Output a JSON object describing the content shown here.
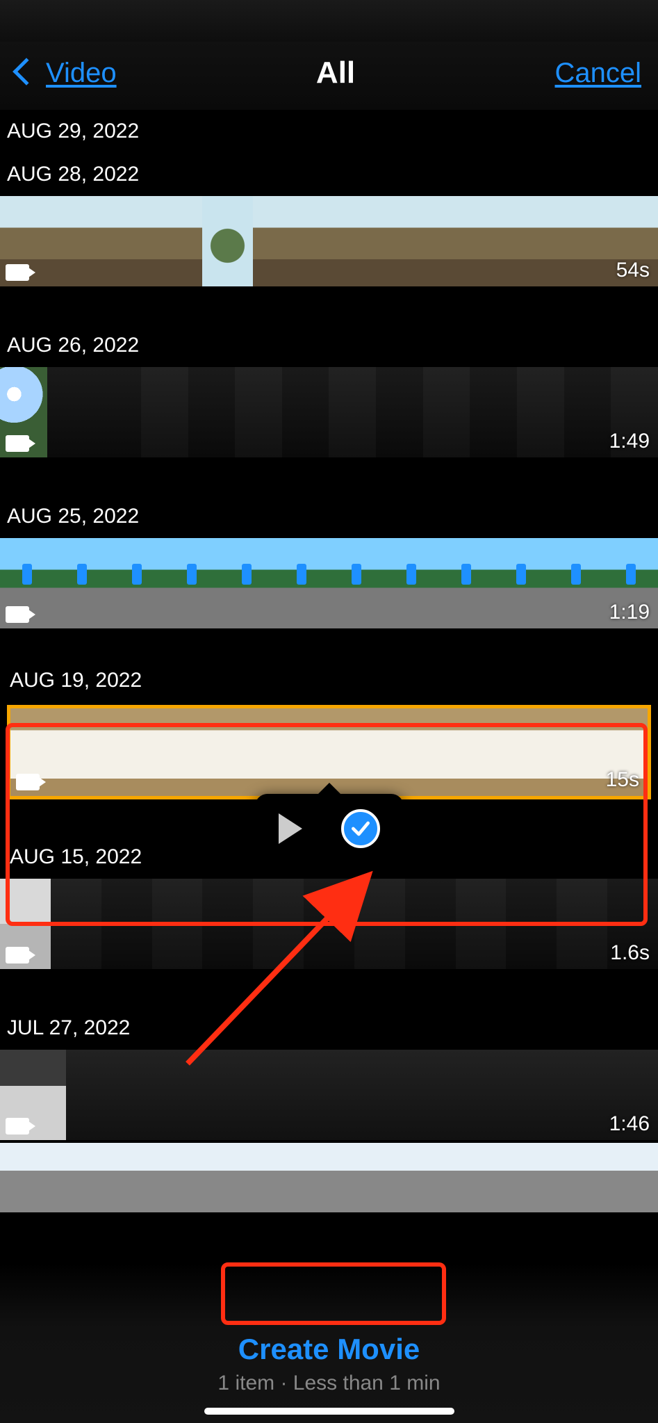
{
  "nav": {
    "back_label": "Video",
    "title": "All",
    "cancel_label": "Cancel"
  },
  "sections": [
    {
      "date": "AUG 29, 2022"
    },
    {
      "date": "AUG 28, 2022",
      "duration": "54s"
    },
    {
      "date": "AUG 26, 2022",
      "duration": "1:49"
    },
    {
      "date": "AUG 25, 2022",
      "duration": "1:19"
    },
    {
      "date": "AUG 19, 2022",
      "duration": "15s",
      "selected": true
    },
    {
      "date": "AUG 15, 2022",
      "duration": "1.6s"
    },
    {
      "date": "JUL 27, 2022",
      "duration": "1:46"
    }
  ],
  "bottom": {
    "create_label": "Create Movie",
    "subtitle": "1 item · Less than 1 min"
  }
}
